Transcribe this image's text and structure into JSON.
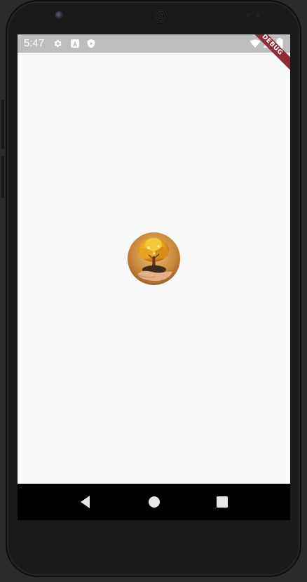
{
  "status_bar": {
    "time": "5:47",
    "icons": [
      "gear-icon",
      "a-badge-icon",
      "play-shield-icon",
      "wifi-icon",
      "signal-icon",
      "battery-icon"
    ],
    "background": "#bdbdbd"
  },
  "debug_banner": {
    "label": "DEBUG",
    "color": "#8e2b35"
  },
  "splash": {
    "logo": "tree-in-hands-logo",
    "background": "#fafafa"
  },
  "nav_bar": {
    "buttons": [
      "back-icon",
      "home-icon",
      "recents-icon"
    ],
    "background": "#000000"
  }
}
